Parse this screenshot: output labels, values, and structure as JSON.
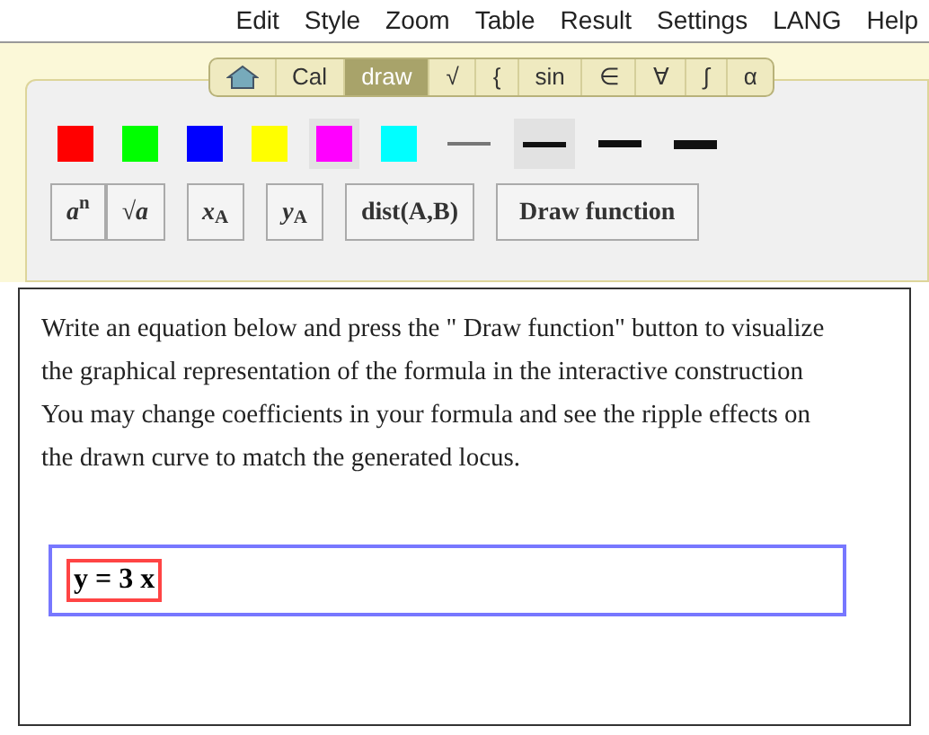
{
  "menu": [
    "Edit",
    "Style",
    "Zoom",
    "Table",
    "Result",
    "Settings",
    "LANG",
    "Help"
  ],
  "tabs": [
    {
      "kind": "home",
      "selected": false
    },
    {
      "kind": "text",
      "label": "Cal",
      "selected": false
    },
    {
      "kind": "text",
      "label": "draw",
      "selected": true
    },
    {
      "kind": "text",
      "label": "√",
      "selected": false
    },
    {
      "kind": "text",
      "label": "{",
      "selected": false
    },
    {
      "kind": "text",
      "label": "sin",
      "selected": false
    },
    {
      "kind": "text",
      "label": "∈",
      "selected": false
    },
    {
      "kind": "text",
      "label": "∀",
      "selected": false
    },
    {
      "kind": "text",
      "label": "∫",
      "selected": false
    },
    {
      "kind": "text",
      "label": "α",
      "selected": false
    }
  ],
  "colors": [
    {
      "color": "#ff0000",
      "selected": false
    },
    {
      "color": "#00ff00",
      "selected": false
    },
    {
      "color": "#0000ff",
      "selected": false
    },
    {
      "color": "#ffff00",
      "selected": false
    },
    {
      "color": "#ff00ff",
      "selected": true
    },
    {
      "color": "#00ffff",
      "selected": false
    }
  ],
  "line_styles": [
    {
      "kind": "thin",
      "selected": false
    },
    {
      "kind": "medium",
      "selected": true
    },
    {
      "kind": "thick",
      "selected": false
    },
    {
      "kind": "heavy",
      "selected": false
    }
  ],
  "buttons": [
    {
      "label": "*a*$^{n}$"
    },
    {
      "label": "√*a*"
    },
    {
      "label": "*x*$_{A}$"
    },
    {
      "label": "*y*$_{A}$"
    },
    {
      "label": "dist(A,B)"
    },
    {
      "label": "Draw function"
    }
  ],
  "instructions": "Write an equation below and press the \" Draw function\" button to visualize the graphical representation of the formula in the interactive construction You may change coefficients in your formula and see the ripple effects on the drawn curve to match the generated locus.",
  "equation": {
    "value": "y = 3 x"
  }
}
